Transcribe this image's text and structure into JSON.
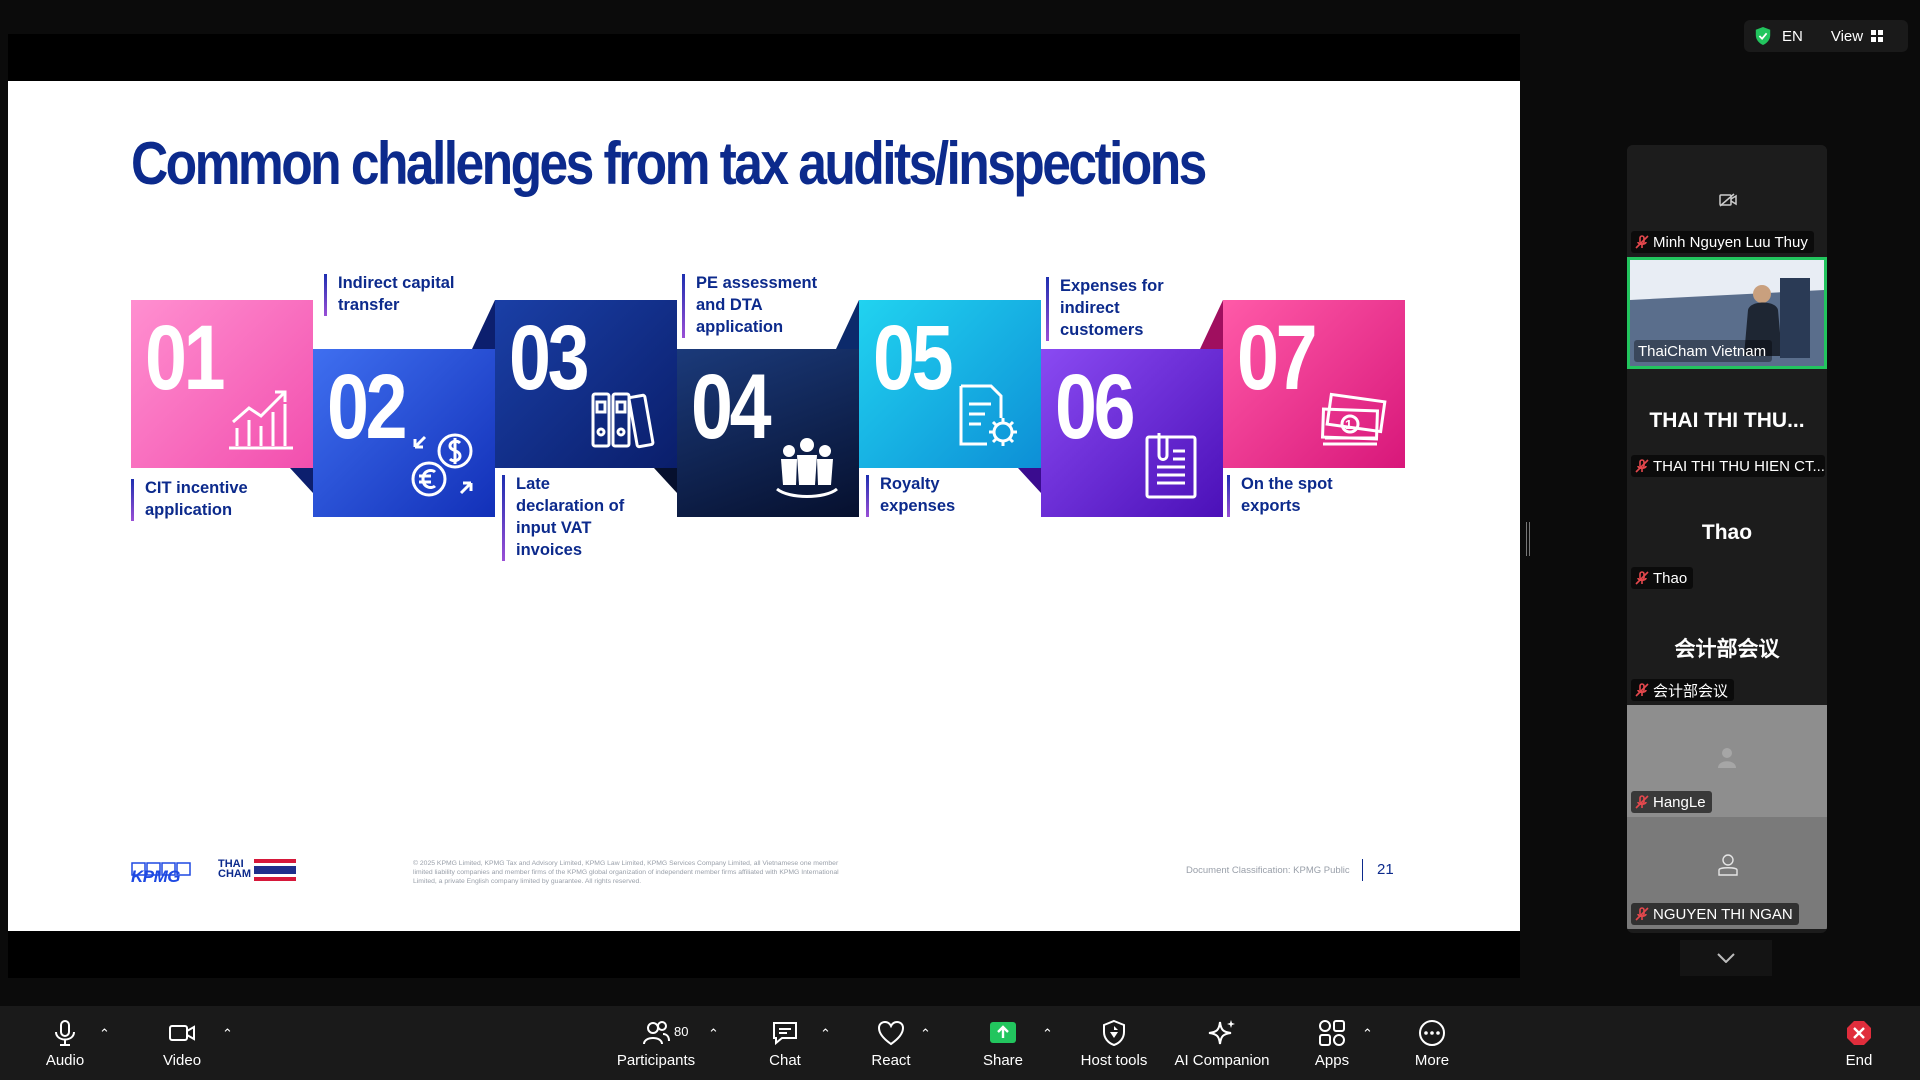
{
  "topbar": {
    "language": "EN",
    "view_label": "View"
  },
  "slide": {
    "title": "Common challenges from tax audits/inspections",
    "items": [
      {
        "num": "01",
        "label": "CIT incentive application"
      },
      {
        "num": "02",
        "label": "Indirect capital transfer"
      },
      {
        "num": "03",
        "label": "Late declaration of input VAT invoices"
      },
      {
        "num": "04",
        "label": "PE assessment and DTA application"
      },
      {
        "num": "05",
        "label": "Royalty expenses"
      },
      {
        "num": "06",
        "label": "Expenses for indirect customers"
      },
      {
        "num": "07",
        "label": "On the spot exports"
      }
    ],
    "footer": {
      "logo_text": "KPMG",
      "partner_logo_text": "THAI CHAM",
      "fine_print": "© 2025 KPMG Limited, KPMG Tax and Advisory Limited, KPMG Law Limited, KPMG Services Company Limited, all Vietnamese  one member limited liability companies and member firms of the KPMG global organization of independent member firms affiliated  with KPMG International Limited, a private English company limited by guarantee. All rights reserved.",
      "classification": "Document Classification: KPMG Public",
      "page_number": "21"
    }
  },
  "participants": [
    {
      "name": "Minh Nguyen Luu Thuy",
      "display": ""
    },
    {
      "name": "ThaiCham Vietnam",
      "display": ""
    },
    {
      "name": "THAI THI THU HIEN CT...",
      "display": "THAI THI THU..."
    },
    {
      "name": "Thao",
      "display": "Thao"
    },
    {
      "name": "会计部会议",
      "display": "会计部会议"
    },
    {
      "name": "HangLe",
      "display": ""
    },
    {
      "name": "NGUYEN THI NGAN",
      "display": ""
    }
  ],
  "toolbar": {
    "audio": "Audio",
    "video": "Video",
    "participants": "Participants",
    "participants_count": "80",
    "chat": "Chat",
    "react": "React",
    "share": "Share",
    "host_tools": "Host tools",
    "ai_companion": "AI Companion",
    "apps": "Apps",
    "more": "More",
    "end": "End"
  }
}
